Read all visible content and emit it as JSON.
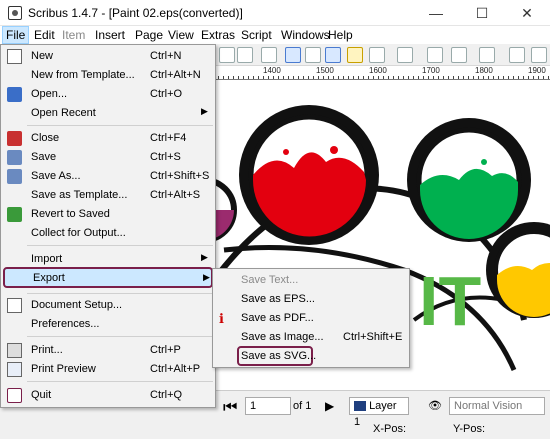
{
  "window": {
    "title": "Scribus 1.4.7 - [Paint 02.eps(converted)]",
    "minimize_glyph": "—",
    "maximize_glyph": "☐",
    "close_glyph": "✕"
  },
  "menubar": {
    "items": [
      "File",
      "Edit",
      "Item",
      "Insert",
      "Page",
      "View",
      "Extras",
      "Script",
      "Windows",
      "Help"
    ]
  },
  "ruler": {
    "labels": [
      "1400",
      "1500",
      "1600",
      "1700",
      "1800",
      "1900"
    ]
  },
  "file_menu": {
    "items": [
      {
        "label": "New",
        "shortcut": "Ctrl+N",
        "icon": "new-document-icon"
      },
      {
        "label": "New from Template...",
        "shortcut": "Ctrl+Alt+N",
        "icon": ""
      },
      {
        "label": "Open...",
        "shortcut": "Ctrl+O",
        "icon": "open-folder-icon"
      },
      {
        "label": "Open Recent",
        "shortcut": "",
        "icon": "",
        "submenu": true
      },
      {
        "label": "Close",
        "shortcut": "Ctrl+F4",
        "icon": "close-document-icon"
      },
      {
        "label": "Save",
        "shortcut": "Ctrl+S",
        "icon": "save-icon"
      },
      {
        "label": "Save As...",
        "shortcut": "Ctrl+Shift+S",
        "icon": "save-as-icon"
      },
      {
        "label": "Save as Template...",
        "shortcut": "Ctrl+Alt+S",
        "icon": ""
      },
      {
        "label": "Revert to Saved",
        "shortcut": "",
        "icon": "revert-icon"
      },
      {
        "label": "Collect for Output...",
        "shortcut": "",
        "icon": ""
      },
      {
        "label": "Import",
        "shortcut": "",
        "icon": "",
        "submenu": true
      },
      {
        "label": "Export",
        "shortcut": "",
        "icon": "",
        "submenu": true
      },
      {
        "label": "Document Setup...",
        "shortcut": "",
        "icon": "document-setup-icon"
      },
      {
        "label": "Preferences...",
        "shortcut": "",
        "icon": ""
      },
      {
        "label": "Print...",
        "shortcut": "Ctrl+P",
        "icon": "print-icon"
      },
      {
        "label": "Print Preview",
        "shortcut": "Ctrl+Alt+P",
        "icon": "print-preview-icon"
      },
      {
        "label": "Quit",
        "shortcut": "Ctrl+Q",
        "icon": "quit-icon"
      }
    ],
    "submenu_arrow": "▶"
  },
  "export_menu": {
    "items": [
      {
        "label": "Save Text...",
        "shortcut": "",
        "disabled": true
      },
      {
        "label": "Save as EPS...",
        "shortcut": ""
      },
      {
        "label": "Save as PDF...",
        "shortcut": "",
        "icon": "pdf-icon"
      },
      {
        "label": "Save as Image...",
        "shortcut": "Ctrl+Shift+E"
      },
      {
        "label": "Save as SVG...",
        "shortcut": "",
        "highlighted": true
      }
    ]
  },
  "canvas": {
    "letters": "IT",
    "colors": {
      "red": "#e3000f",
      "green": "#00b04f",
      "yellow": "#ffc800",
      "purple": "#9b2b6e",
      "letter_green": "#57b847"
    }
  },
  "statusbar": {
    "page_value": "1",
    "page_of": "of 1",
    "layer": "Layer 1",
    "view_mode": "Normal Vision",
    "xpos_label": "X-Pos:",
    "ypos_label": "Y-Pos:",
    "zoom_value": "",
    "unit_value": ""
  },
  "accent_highlight": "#7a1f4a"
}
